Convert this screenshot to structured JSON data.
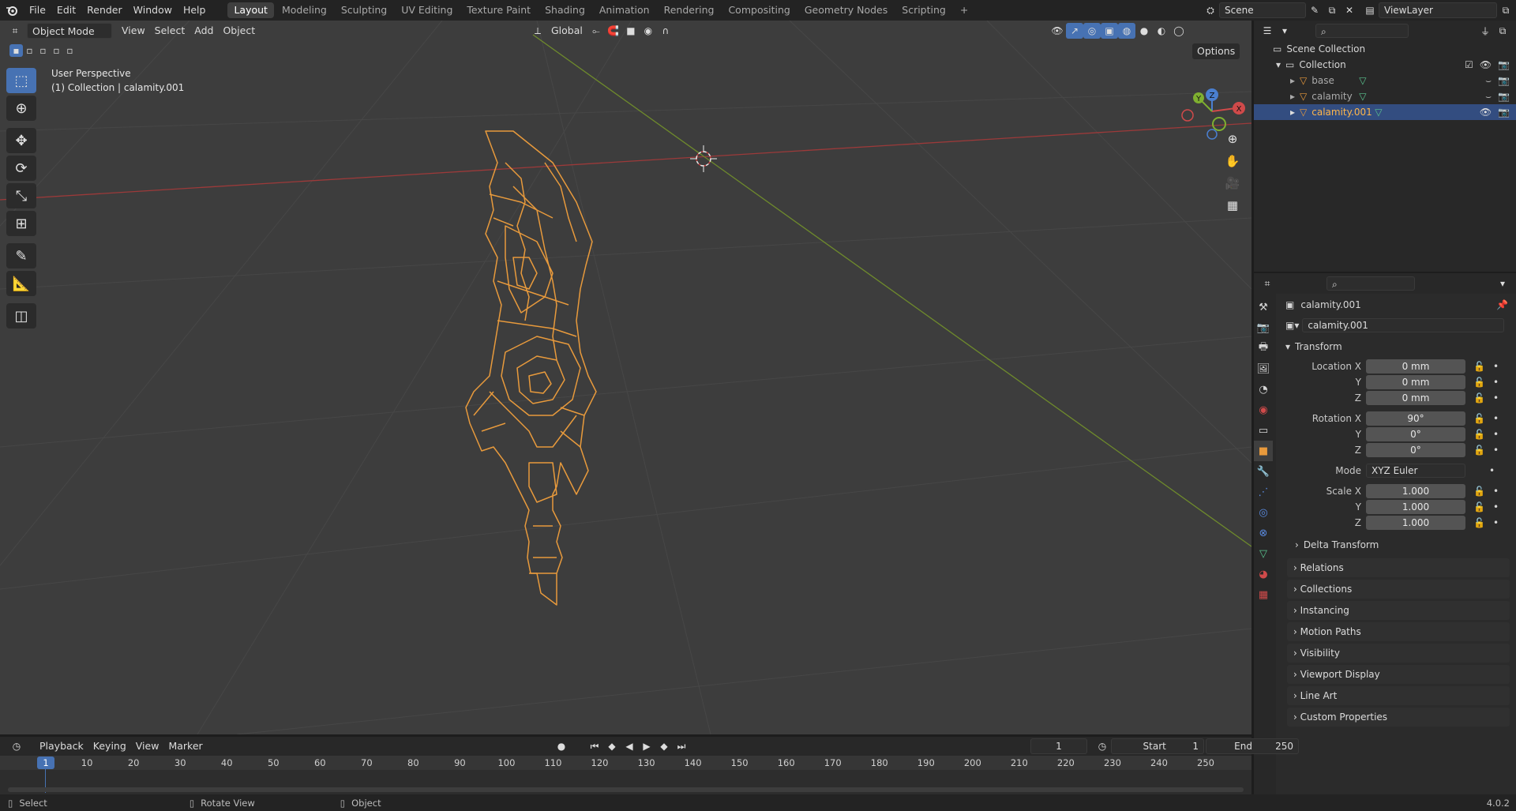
{
  "topbar": {
    "menu": [
      "File",
      "Edit",
      "Render",
      "Window",
      "Help"
    ],
    "workspaces": [
      "Layout",
      "Modeling",
      "Sculpting",
      "UV Editing",
      "Texture Paint",
      "Shading",
      "Animation",
      "Rendering",
      "Compositing",
      "Geometry Nodes",
      "Scripting"
    ],
    "active_workspace": "Layout",
    "add_tab": "+",
    "scene": "Scene",
    "view_layer": "ViewLayer"
  },
  "viewport": {
    "mode": "Object Mode",
    "menus": [
      "View",
      "Select",
      "Add",
      "Object"
    ],
    "orientation": "Global",
    "options": "Options",
    "perspective": "User Perspective",
    "collection_info": "(1) Collection | calamity.001",
    "gizmo": {
      "z": "Z",
      "y": "Y",
      "x": "X"
    },
    "colors": {
      "background": "#3d3d3d",
      "x_axis": "#9c3a3a",
      "y_axis": "#6e8a2c",
      "selection": "#e89a3c",
      "active": "#4772b3"
    }
  },
  "outliner": {
    "root": "Scene Collection",
    "collection": "Collection",
    "items": [
      {
        "name": "base",
        "selected": false
      },
      {
        "name": "calamity",
        "selected": false
      },
      {
        "name": "calamity.001",
        "selected": true
      }
    ]
  },
  "properties": {
    "object_name": "calamity.001",
    "datablock_name": "calamity.001",
    "transform_header": "Transform",
    "location": {
      "label": "Location X",
      "y_label": "Y",
      "z_label": "Z",
      "x": "0 mm",
      "y": "0 mm",
      "z": "0 mm"
    },
    "rotation": {
      "label": "Rotation X",
      "y_label": "Y",
      "z_label": "Z",
      "x": "90°",
      "y": "0°",
      "z": "0°"
    },
    "mode": {
      "label": "Mode",
      "value": "XYZ Euler"
    },
    "scale": {
      "label": "Scale X",
      "y_label": "Y",
      "z_label": "Z",
      "x": "1.000",
      "y": "1.000",
      "z": "1.000"
    },
    "delta_transform": "Delta Transform",
    "panels": [
      "Relations",
      "Collections",
      "Instancing",
      "Motion Paths",
      "Visibility",
      "Viewport Display",
      "Line Art",
      "Custom Properties"
    ]
  },
  "timeline": {
    "menus": [
      "Playback",
      "Keying",
      "View",
      "Marker"
    ],
    "current_frame": "1",
    "start_label": "Start",
    "start": "1",
    "end_label": "End",
    "end": "250",
    "ruler": [
      "10",
      "20",
      "30",
      "40",
      "50",
      "60",
      "70",
      "80",
      "90",
      "100",
      "110",
      "120",
      "130",
      "140",
      "150",
      "160",
      "170",
      "180",
      "190",
      "200",
      "210",
      "220",
      "230",
      "240",
      "250"
    ],
    "playhead": "1"
  },
  "statusbar": {
    "select": "Select",
    "rotate": "Rotate View",
    "object": "Object",
    "version": "4.0.2"
  }
}
